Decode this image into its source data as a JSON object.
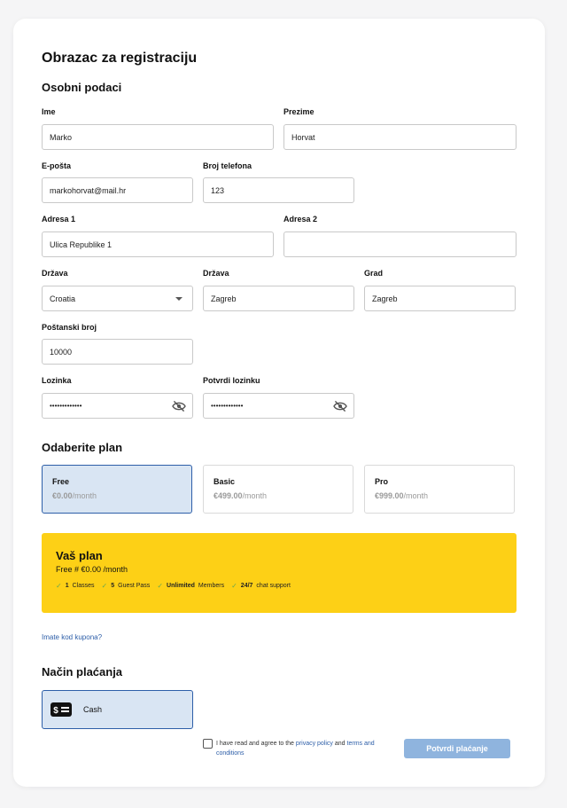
{
  "form": {
    "title": "Obrazac za registraciju",
    "personal_section": "Osobni podaci",
    "fields": {
      "first_name": {
        "label": "Ime",
        "value": "Marko"
      },
      "last_name": {
        "label": "Prezime",
        "value": "Horvat"
      },
      "email": {
        "label": "E-pošta",
        "value": "markohorvat@mail.hr"
      },
      "phone": {
        "label": "Broj telefona",
        "value": "123"
      },
      "address1": {
        "label": "Adresa 1",
        "value": "Ulica Republike 1"
      },
      "address2": {
        "label": "Adresa 2",
        "value": ""
      },
      "country": {
        "label": "Država",
        "value": "Croatia"
      },
      "state": {
        "label": "Država",
        "value": "Zagreb"
      },
      "city": {
        "label": "Grad",
        "value": "Zagreb"
      },
      "postal": {
        "label": "Poštanski broj",
        "value": "10000"
      },
      "password": {
        "label": "Lozinka",
        "value": "•••••••••••••"
      },
      "confirm_password": {
        "label": "Potvrdi lozinku",
        "value": "•••••••••••••"
      }
    }
  },
  "plans": {
    "title": "Odaberite plan",
    "items": [
      {
        "name": "Free",
        "price": "€0.00",
        "period": "/month",
        "selected": true
      },
      {
        "name": "Basic",
        "price": "€499.00",
        "period": "/month",
        "selected": false
      },
      {
        "name": "Pro",
        "price": "€999.00",
        "period": "/month",
        "selected": false
      }
    ]
  },
  "summary": {
    "title": "Vaš plan",
    "subtitle": "Free # €0.00 /month",
    "features": [
      {
        "bold": "1",
        "text": "Classes"
      },
      {
        "bold": "5",
        "text": "Guest Pass"
      },
      {
        "bold": "Unlimited",
        "text": "Members"
      },
      {
        "bold": "24/7",
        "text": "chat support"
      }
    ],
    "check_color": "#6aa84f",
    "background": "#fdd016"
  },
  "coupon_link": "Imate kod kupona?",
  "payment": {
    "title": "Način plaćanja",
    "method": "Cash"
  },
  "terms": {
    "prefix": "I have read and agree to the",
    "privacy": "privacy policy",
    "and": "and",
    "terms": "terms and conditions"
  },
  "submit_label": "Potvrdi plaćanje",
  "colors": {
    "accent": "#2d5ea8",
    "button": "#8fb4de"
  }
}
